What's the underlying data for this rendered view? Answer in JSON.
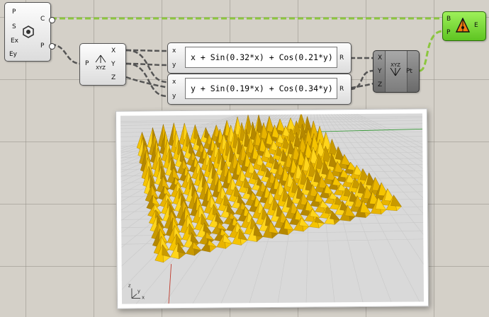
{
  "canvas": {
    "background": "#d4d0c8",
    "wire_color": "#555555",
    "selected_wire_color": "#8cc63f"
  },
  "rectangle_node": {
    "inputs": [
      "P",
      "S",
      "Ex",
      "Ey"
    ],
    "outputs": [
      "C",
      "P"
    ],
    "icon": "hexagon-gear-icon"
  },
  "deconstruct_node": {
    "input": "P",
    "icon_text": "XYZ",
    "outputs": [
      "X",
      "Y",
      "Z"
    ]
  },
  "expression_x": {
    "inputs": [
      "x",
      "y"
    ],
    "expression": "x + Sin(0.32*x) + Cos(0.21*y)",
    "output": "R"
  },
  "expression_y": {
    "inputs": [
      "x",
      "y"
    ],
    "expression": "y + Sin(0.19*x) + Cos(0.34*y)",
    "output": "R"
  },
  "construct_point_node": {
    "inputs": [
      "X",
      "Y",
      "Z"
    ],
    "icon_text": "XYZ",
    "output": "Pt"
  },
  "pyramid_node": {
    "inputs": [
      "B",
      "P"
    ],
    "output": "E",
    "icon": "pyramid-icon",
    "color": "#7ddc3a"
  },
  "viewport": {
    "axis_x_label": "x",
    "axis_y_label": "y",
    "axis_z_label": "z",
    "spike_color": "#f5c400",
    "grid_color": "#c8c8c8"
  }
}
